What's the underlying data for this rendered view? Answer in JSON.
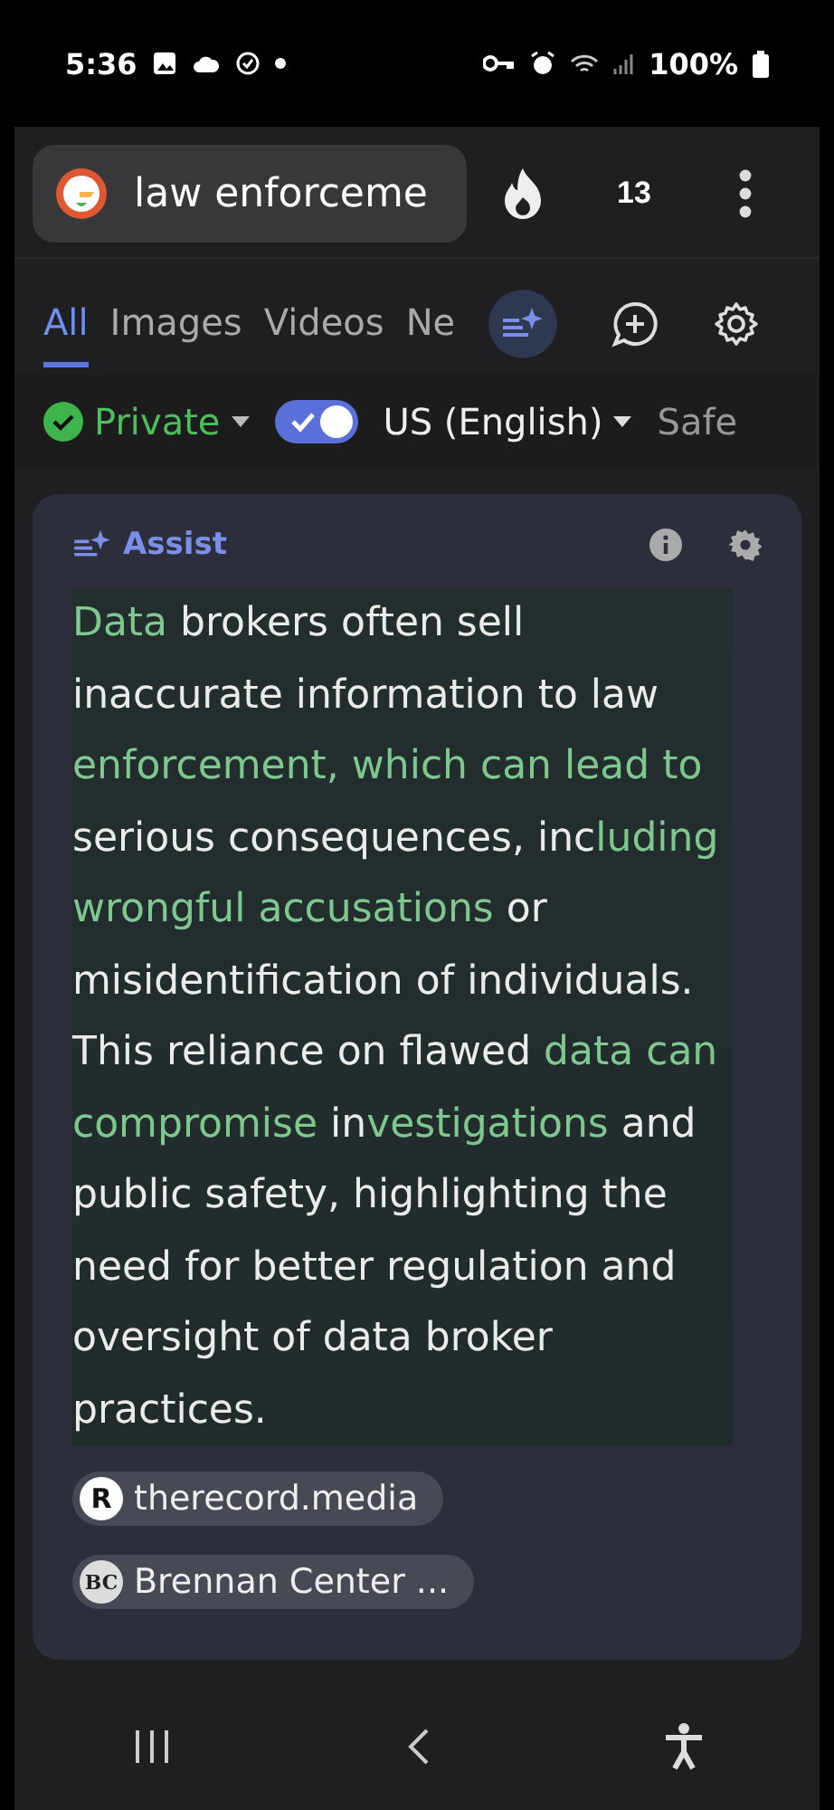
{
  "status_bar": {
    "time": "5:36",
    "battery": "100%"
  },
  "search": {
    "value": "law enforceme",
    "tab_count": "13"
  },
  "tabs": [
    {
      "label": "All",
      "selected": true
    },
    {
      "label": "Images",
      "selected": false
    },
    {
      "label": "Videos",
      "selected": false
    },
    {
      "label": "Ne",
      "selected": false
    }
  ],
  "filters": {
    "private": {
      "label": "Private"
    },
    "region": {
      "label": "US (English)",
      "on": true
    },
    "safe": {
      "label": "Safe"
    }
  },
  "assist": {
    "title": "Assist",
    "segments": [
      {
        "text": "Data",
        "highlighted": true
      },
      {
        "text": " brokers often sell inaccurate information to law ",
        "highlighted": false
      },
      {
        "text": "enforcement, which can lead to",
        "highlighted": true
      },
      {
        "text": " serious consequences, inc",
        "highlighted": false
      },
      {
        "text": "luding wrongful accusations",
        "highlighted": true
      },
      {
        "text": " or misidentification of individuals. This reliance on flawed ",
        "highlighted": false
      },
      {
        "text": "data can compromise",
        "highlighted": true
      },
      {
        "text": " in",
        "highlighted": false
      },
      {
        "text": "vestigations",
        "highlighted": true
      },
      {
        "text": " and public safety, highlighting the need for better regulation and oversight of data broker practices.",
        "highlighted": false
      }
    ],
    "sources": [
      {
        "logo": "R",
        "label": "therecord.media"
      },
      {
        "logo": "BC",
        "label": "Brennan Center ..."
      }
    ]
  }
}
